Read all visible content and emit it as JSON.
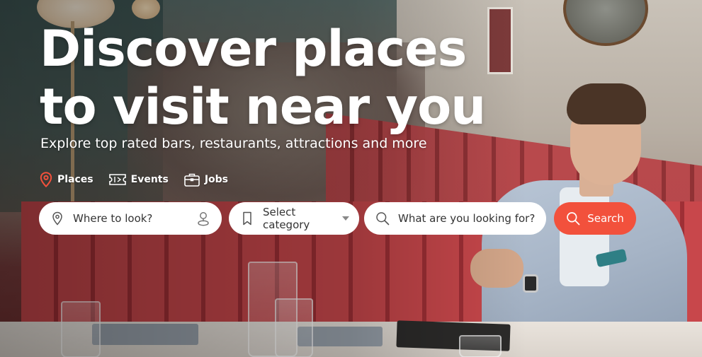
{
  "hero": {
    "title_line1": "Discover places",
    "title_line2": "to visit near you",
    "subtitle": "Explore top rated bars, restaurants, attractions and more"
  },
  "quick_links": [
    {
      "label": "Places",
      "icon": "map-pin-icon",
      "color": "#f2513c"
    },
    {
      "label": "Events",
      "icon": "ticket-icon"
    },
    {
      "label": "Jobs",
      "icon": "briefcase-icon"
    }
  ],
  "search": {
    "location_placeholder": "Where to look?",
    "location_lead_icon": "location-pin-icon",
    "location_trail_icon": "user-location-icon",
    "category_value": "Select category",
    "category_lead_icon": "bookmark-icon",
    "category_trail_icon": "caret-down-icon",
    "query_placeholder": "What are you looking for?",
    "query_icon": "search-icon",
    "button_label": "Search",
    "button_color": "#f2513c"
  }
}
